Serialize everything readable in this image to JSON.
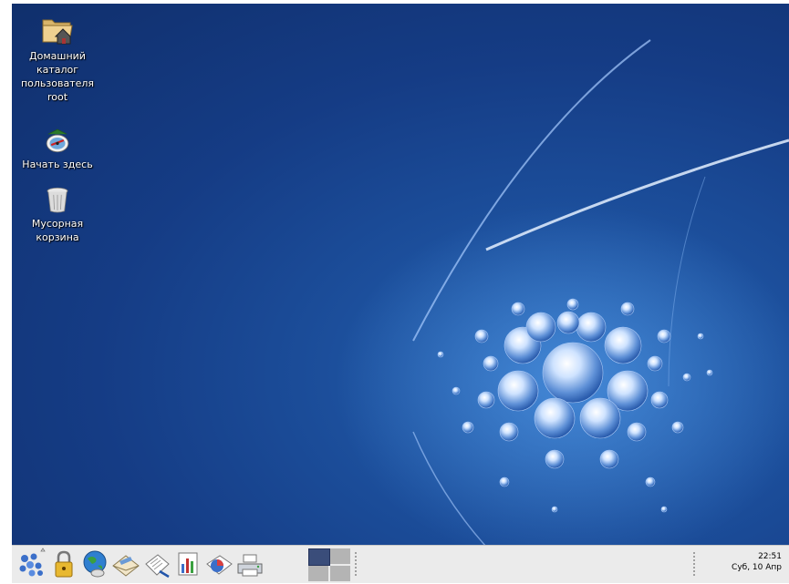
{
  "desktop": {
    "icons": [
      {
        "label_lines": [
          "Домашний",
          "каталог",
          "пользователя",
          "root"
        ],
        "icon": "home-folder-icon"
      },
      {
        "label_lines": [
          "Начать здесь"
        ],
        "icon": "start-here-icon"
      },
      {
        "label_lines": [
          "Мусорная",
          "корзина"
        ],
        "icon": "trash-icon"
      }
    ]
  },
  "panel": {
    "launchers": [
      {
        "icon": "main-menu-icon"
      },
      {
        "icon": "lock-icon"
      },
      {
        "icon": "web-browser-icon"
      },
      {
        "icon": "email-icon"
      },
      {
        "icon": "word-processor-icon"
      },
      {
        "icon": "spreadsheet-icon"
      },
      {
        "icon": "presentation-icon"
      },
      {
        "icon": "print-manager-icon"
      }
    ],
    "clock": {
      "time": "22:51",
      "date": "Суб, 10 Апр"
    }
  },
  "colors": {
    "desktop_bg": "#153c85",
    "panel_bg": "#ebebeb",
    "pager_active": "#3a4d7a",
    "pager_inactive": "#b4b4b4"
  }
}
